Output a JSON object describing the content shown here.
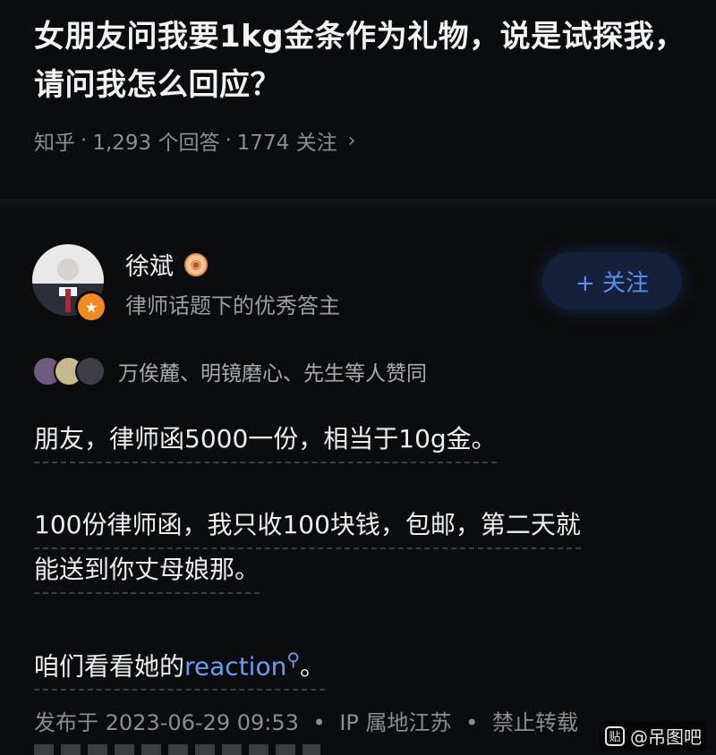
{
  "question": {
    "title": "女朋友问我要1kg金条作为礼物，说是试探我，请问我怎么回应？",
    "source": "知乎",
    "answers_count": "1,293 个回答",
    "followers": "1774 关注",
    "chevron": "›"
  },
  "author": {
    "name": "徐斌",
    "description": "律师话题下的优秀答主",
    "follow_label": "+ 关注",
    "verified_badge_icon": "eye-badge-icon",
    "avatar_badge_icon": "star-badge-icon"
  },
  "upvoters": {
    "text": "万俟麓、明镜磨心、先生等人赞同"
  },
  "answer": {
    "p1": "朋友，律师函5000一份，相当于10g金。",
    "p2_line1": "100份律师函，我只收100块钱，包邮，第二天就",
    "p2_line2": "能送到你丈母娘那。",
    "p3_prefix": "咱们看看她的",
    "p3_keyword": "reaction",
    "p3_suffix": "。"
  },
  "footer": {
    "published": "发布于 2023-06-29 09:53",
    "ip": "IP 属地江苏",
    "repost": "禁止转载",
    "separator": "•"
  },
  "watermark": {
    "logo": "贴",
    "text": "@吊图吧"
  },
  "colors": {
    "background": "#0b0c0e",
    "accent": "#6b9cf5",
    "badge_orange": "#f08a21"
  }
}
